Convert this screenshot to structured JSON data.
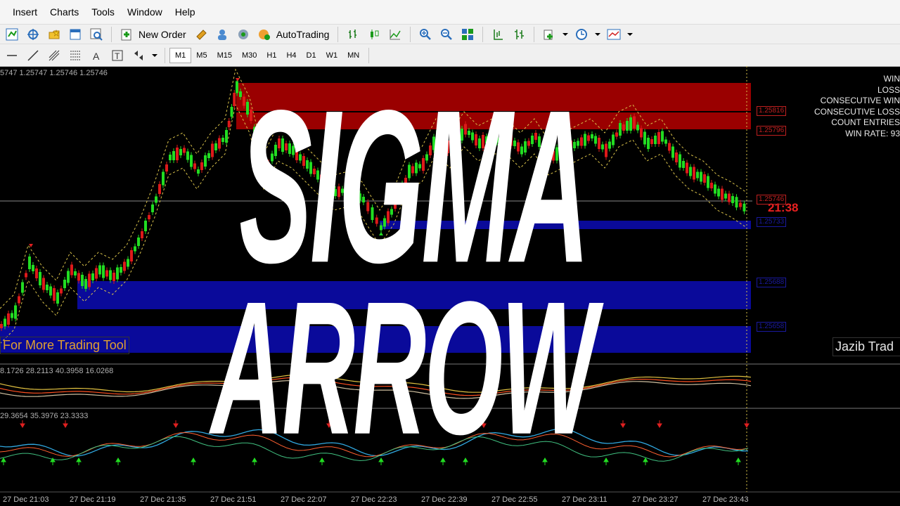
{
  "menu": {
    "items": [
      "Insert",
      "Charts",
      "Tools",
      "Window",
      "Help"
    ]
  },
  "toolbar": {
    "new_order_label": "New Order",
    "autotrading_label": "AutoTrading",
    "timeframes": [
      "M1",
      "M5",
      "M15",
      "M30",
      "H1",
      "H4",
      "D1",
      "W1",
      "MN"
    ],
    "active_timeframe": "M1"
  },
  "chart": {
    "ohlc_info": "5747 1.25747 1.25746 1.25746",
    "indicator1_values": "8.1726 28.2113 40.3958 16.0268",
    "indicator2_values": "29.3654 35.3976 23.3333",
    "countdown": "21:38",
    "price_levels": {
      "red_top": "1.25816",
      "red_second": "1.25796",
      "current": "1.25746",
      "blue_current": "1.25733",
      "blue_mid": "1.25688",
      "blue_low": "1.25658"
    },
    "tool_label": "For More Trading Tool",
    "jazib_label": "Jazib Trad",
    "time_axis": [
      "27 Dec 21:03",
      "27 Dec 21:19",
      "27 Dec 21:35",
      "27 Dec 21:51",
      "27 Dec 22:07",
      "27 Dec 22:23",
      "27 Dec 22:39",
      "27 Dec 22:55",
      "27 Dec 23:11",
      "27 Dec 23:27",
      "27 Dec 23:43"
    ]
  },
  "stats_panel": {
    "lines": [
      "WIN",
      "LOSS",
      "CONSECUTIVE WIN",
      "CONSECUTIVE LOSS",
      "COUNT ENTRIES",
      "WIN RATE: 93"
    ]
  },
  "overlay_title": {
    "line1": "SIGMA",
    "line2": "ARROW"
  },
  "colors": {
    "bull_candle": "#22dd22",
    "bear_candle": "#dd1a1a",
    "red_zone": "#9a0000",
    "blue_zone": "#0a0a9a",
    "band": "#d9c24a"
  }
}
